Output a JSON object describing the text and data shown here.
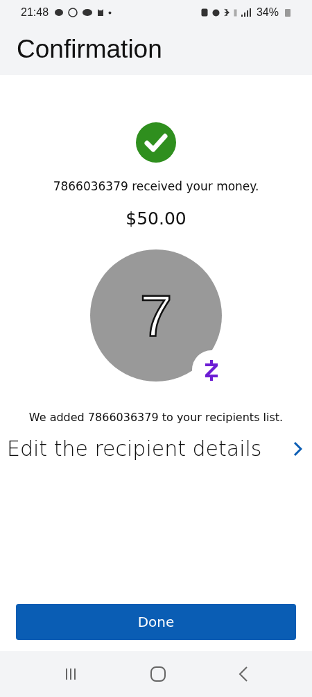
{
  "status_bar": {
    "time": "21:48",
    "battery": "34%"
  },
  "header": {
    "title": "Confirmation"
  },
  "confirmation": {
    "message": "7866036379 received your money.",
    "amount": "$50.00",
    "avatar_initial": "7",
    "note": "We added 7866036379 to your recipients list.",
    "edit_link": "Edit the recipient details"
  },
  "buttons": [
    {
      "label": "Done"
    }
  ]
}
